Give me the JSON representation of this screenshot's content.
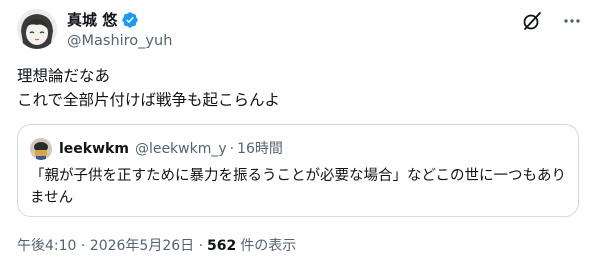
{
  "author": {
    "display_name": "真城 悠",
    "handle": "@Mashiro_yuh",
    "verified": true,
    "verified_color": "#1d9bf0"
  },
  "post": {
    "lines": [
      "理想論だなあ",
      "これで全部片付けば戦争も起こらんよ"
    ]
  },
  "quote": {
    "name": "leekwkm",
    "handle": "@leekwkm_y",
    "separator": "·",
    "time": "16時間",
    "text": "「親が子供を正すために暴力を振るうことが必要な場合」などこの世に一つもありません"
  },
  "meta": {
    "timestamp": "午後4:10 · 2026年5月26日 ·",
    "views": "562",
    "views_label": "件の表示"
  },
  "icons": {
    "grok": "grok-icon",
    "more": "more-icon"
  }
}
